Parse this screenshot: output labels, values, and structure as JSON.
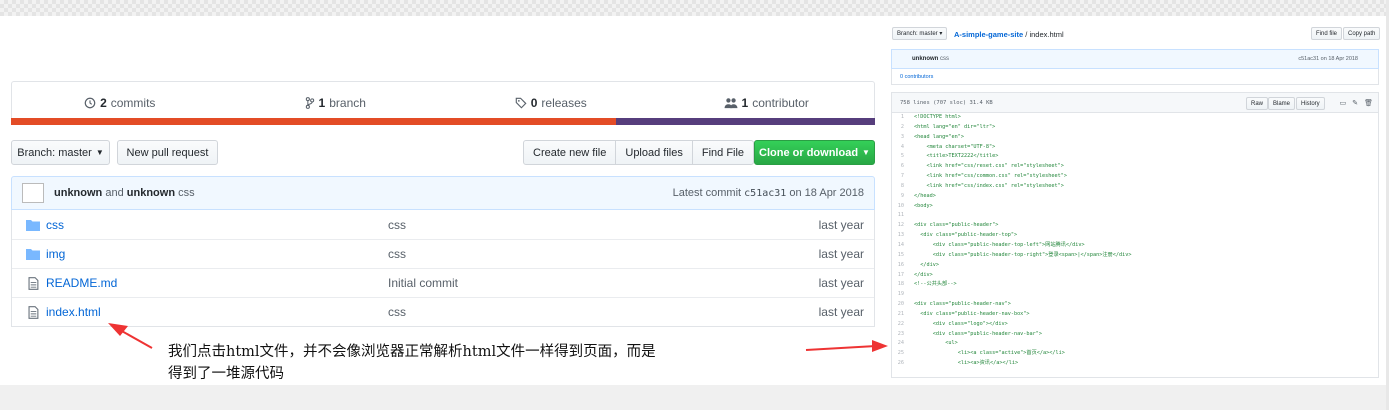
{
  "repo_summary": {
    "commits_count": "2",
    "commits_label": "commits",
    "branch_count": "1",
    "branch_label": "branch",
    "releases_count": "0",
    "releases_label": "releases",
    "contributor_count": "1",
    "contributor_label": "contributor"
  },
  "language_colors": {
    "html": "#e34c26",
    "css": "#563d7c"
  },
  "toolbar": {
    "branch_select": "Branch: master",
    "new_pull_request": "New pull request",
    "create_new_file": "Create new file",
    "upload_files": "Upload files",
    "find_file": "Find File",
    "clone_download": "Clone or download"
  },
  "latest_commit": {
    "author1": "unknown",
    "and_text": "and",
    "author2": "unknown",
    "message": "css",
    "label": "Latest commit",
    "sha": "c51ac31",
    "date": "on 18 Apr 2018"
  },
  "files": [
    {
      "name": "css",
      "type": "dir",
      "message": "css",
      "age": "last year"
    },
    {
      "name": "img",
      "type": "dir",
      "message": "css",
      "age": "last year"
    },
    {
      "name": "README.md",
      "type": "file",
      "message": "Initial commit",
      "age": "last year"
    },
    {
      "name": "index.html",
      "type": "file",
      "message": "css",
      "age": "last year"
    }
  ],
  "annotation": {
    "line1": "我们点击html文件，并不会像浏览器正常解析html文件一样得到页面，而是",
    "line2": "得到了一堆源代码"
  },
  "mini_view": {
    "branch_select": "Branch: master",
    "repo_name": "A-simple-game-site",
    "separator": "/",
    "file_name": "index.html",
    "find_file": "Find file",
    "copy_path": "Copy path",
    "commit_author": "unknown",
    "commit_message": "css",
    "commit_meta": "c51ac31 on 18 Apr 2018",
    "contributors": "0 contributors",
    "file_info": "758 lines (707 sloc)  31.4 KB",
    "raw": "Raw",
    "blame": "Blame",
    "history": "History",
    "code_lines": [
      {
        "n": "1",
        "t": "<!DOCTYPE html>"
      },
      {
        "n": "2",
        "t": "<html lang=\"en\" dir=\"ltr\">"
      },
      {
        "n": "3",
        "t": "<head lang=\"en\">"
      },
      {
        "n": "4",
        "t": "    <meta charset=\"UTF-8\">"
      },
      {
        "n": "5",
        "t": "    <title>TEXT2222</title>"
      },
      {
        "n": "6",
        "t": "    <link href=\"css/reset.css\" rel=\"stylesheet\">"
      },
      {
        "n": "7",
        "t": "    <link href=\"css/common.css\" rel=\"stylesheet\">"
      },
      {
        "n": "8",
        "t": "    <link href=\"css/index.css\" rel=\"stylesheet\">"
      },
      {
        "n": "9",
        "t": "</head>"
      },
      {
        "n": "10",
        "t": "<body>"
      },
      {
        "n": "11",
        "t": ""
      },
      {
        "n": "12",
        "t": "<div class=\"public-header\">"
      },
      {
        "n": "13",
        "t": "  <div class=\"public-header-top\">"
      },
      {
        "n": "14",
        "t": "      <div class=\"public-header-top-left\">网站腾讯</div>"
      },
      {
        "n": "15",
        "t": "      <div class=\"public-header-top-right\">登录<span>|</span>注册</div>"
      },
      {
        "n": "16",
        "t": "  </div>"
      },
      {
        "n": "17",
        "t": "</div>"
      },
      {
        "n": "18",
        "t": "<!--公共头部-->"
      },
      {
        "n": "19",
        "t": ""
      },
      {
        "n": "20",
        "t": "<div class=\"public-header-nav\">"
      },
      {
        "n": "21",
        "t": "  <div class=\"public-header-nav-box\">"
      },
      {
        "n": "22",
        "t": "      <div class=\"logo\"></div>"
      },
      {
        "n": "23",
        "t": "      <div class=\"public-header-nav-bar\">"
      },
      {
        "n": "24",
        "t": "          <ul>"
      },
      {
        "n": "25",
        "t": "              <li><a class=\"active\">首页</a></li>"
      },
      {
        "n": "26",
        "t": "              <li><a>资讯</a></li>"
      }
    ]
  }
}
